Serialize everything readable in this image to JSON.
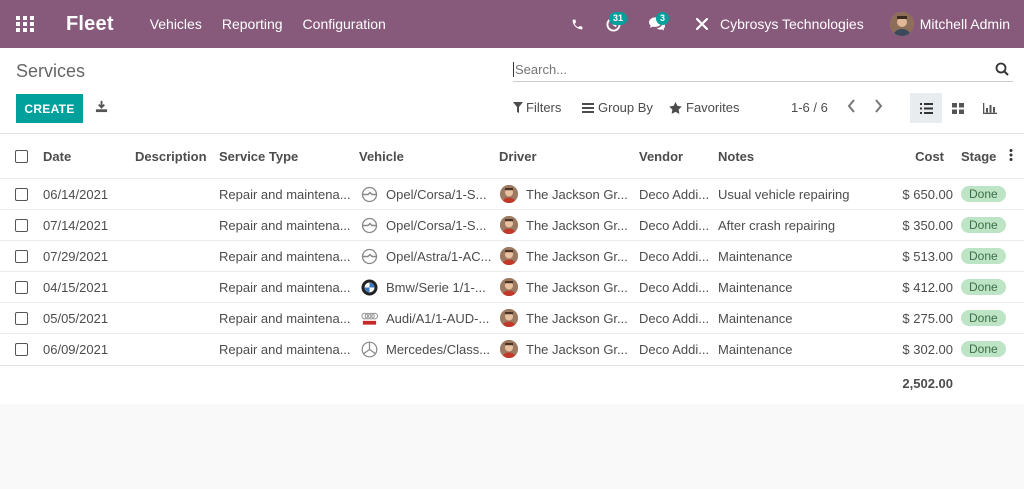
{
  "navbar": {
    "brand": "Fleet",
    "menu": [
      "Vehicles",
      "Reporting",
      "Configuration"
    ],
    "activity_count": "31",
    "message_count": "3",
    "company": "Cybrosys Technologies",
    "user": "Mitchell Admin",
    "colors": {
      "bar": "#875a7b",
      "badge": "#00a09d"
    }
  },
  "control": {
    "title": "Services",
    "create_label": "CREATE",
    "search_placeholder": "Search...",
    "filters_label": "Filters",
    "group_by_label": "Group By",
    "favorites_label": "Favorites",
    "pager": "1-6 / 6"
  },
  "table": {
    "columns": [
      "Date",
      "Description",
      "Service Type",
      "Vehicle",
      "Driver",
      "Vendor",
      "Notes",
      "Cost",
      "Stage"
    ],
    "rows": [
      {
        "date": "06/14/2021",
        "description": "",
        "service_type": "Repair and maintena...",
        "vehicle": "Opel/Corsa/1-S...",
        "vehicle_logo": "opel-logo-icon",
        "driver": "The Jackson Gr...",
        "vendor": "Deco Addi...",
        "notes": "Usual vehicle repairing",
        "cost": "$ 650.00",
        "stage": "Done"
      },
      {
        "date": "07/14/2021",
        "description": "",
        "service_type": "Repair and maintena...",
        "vehicle": "Opel/Corsa/1-S...",
        "vehicle_logo": "opel-logo-icon",
        "driver": "The Jackson Gr...",
        "vendor": "Deco Addi...",
        "notes": "After crash repairing",
        "cost": "$ 350.00",
        "stage": "Done"
      },
      {
        "date": "07/29/2021",
        "description": "",
        "service_type": "Repair and maintena...",
        "vehicle": "Opel/Astra/1-AC...",
        "vehicle_logo": "opel-logo-icon",
        "driver": "The Jackson Gr...",
        "vendor": "Deco Addi...",
        "notes": "Maintenance",
        "cost": "$ 513.00",
        "stage": "Done"
      },
      {
        "date": "04/15/2021",
        "description": "",
        "service_type": "Repair and maintena...",
        "vehicle": "Bmw/Serie 1/1-...",
        "vehicle_logo": "bmw-logo-icon",
        "driver": "The Jackson Gr...",
        "vendor": "Deco Addi...",
        "notes": "Maintenance",
        "cost": "$ 412.00",
        "stage": "Done"
      },
      {
        "date": "05/05/2021",
        "description": "",
        "service_type": "Repair and maintena...",
        "vehicle": "Audi/A1/1-AUD-...",
        "vehicle_logo": "audi-logo-icon",
        "driver": "The Jackson Gr...",
        "vendor": "Deco Addi...",
        "notes": "Maintenance",
        "cost": "$ 275.00",
        "stage": "Done"
      },
      {
        "date": "06/09/2021",
        "description": "",
        "service_type": "Repair and maintena...",
        "vehicle": "Mercedes/Class...",
        "vehicle_logo": "mercedes-logo-icon",
        "driver": "The Jackson Gr...",
        "vendor": "Deco Addi...",
        "notes": "Maintenance",
        "cost": "$ 302.00",
        "stage": "Done"
      }
    ],
    "total_cost": "2,502.00",
    "stage_color": "#bde4c5"
  }
}
